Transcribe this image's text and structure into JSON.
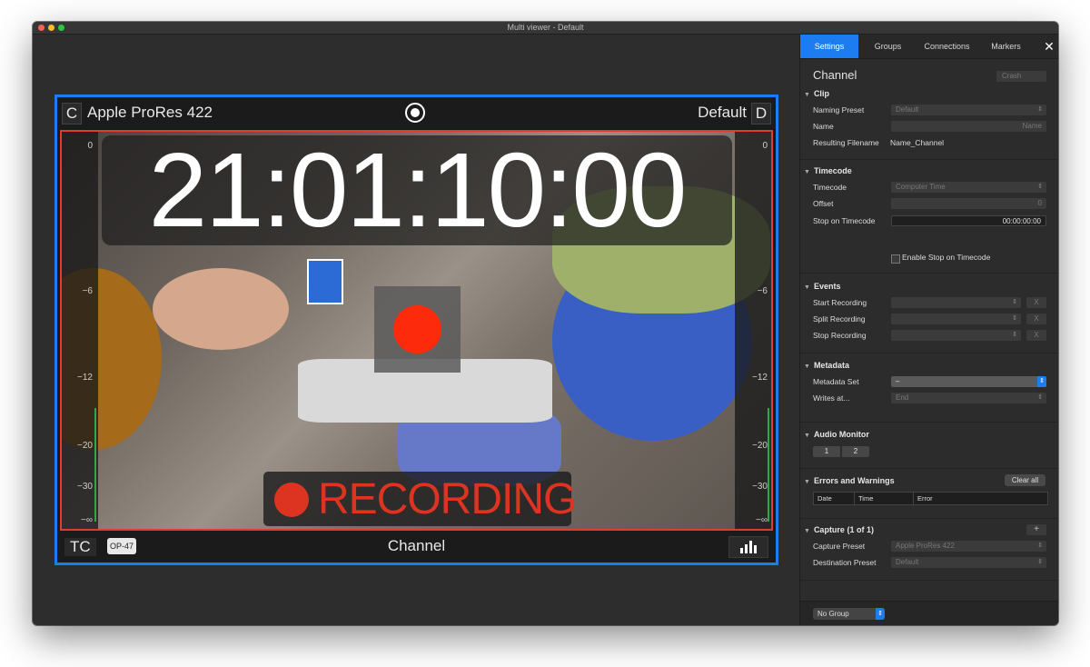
{
  "window": {
    "title": "Multi viewer - Default"
  },
  "viewer": {
    "left_letter": "C",
    "codec": "Apple ProRes 422",
    "preset": "Default",
    "right_letter": "D",
    "timecode": "21:01:10:00",
    "recording_label": "RECORDING",
    "tc_label": "TC",
    "op_badge": "OP-47",
    "channel_name": "Channel",
    "meter_labels": [
      "0",
      "−6",
      "−12",
      "−20",
      "−30",
      "−∞"
    ]
  },
  "panel": {
    "tabs": [
      "Settings",
      "Groups",
      "Connections",
      "Markers"
    ],
    "active_tab": "Settings",
    "close": "✕",
    "channel_title": "Channel",
    "channel_select": "Crash",
    "clip": {
      "header": "Clip",
      "naming_preset_label": "Naming Preset",
      "naming_preset_value": "Default",
      "name_label": "Name",
      "name_placeholder": "Name",
      "resulting_filename_label": "Resulting Filename",
      "resulting_filename_value": "Name_Channel"
    },
    "timecode": {
      "header": "Timecode",
      "timecode_label": "Timecode",
      "timecode_value": "Computer Time",
      "offset_label": "Offset",
      "offset_value": "0",
      "stop_label": "Stop on Timecode",
      "stop_value": "00:00:00:00",
      "enable_label": "Enable Stop on Timecode"
    },
    "events": {
      "header": "Events",
      "rows": [
        "Start Recording",
        "Split Recording",
        "Stop Recording"
      ],
      "clear_symbol": "X"
    },
    "metadata": {
      "header": "Metadata",
      "set_label": "Metadata Set",
      "set_value": "–",
      "writes_label": "Writes at...",
      "writes_value": "End"
    },
    "audio_monitor": {
      "header": "Audio Monitor",
      "channels": [
        "1",
        "2"
      ]
    },
    "errors": {
      "header": "Errors and Warnings",
      "clear_all": "Clear all",
      "columns": [
        "Date",
        "Time",
        "Error"
      ]
    },
    "capture": {
      "header": "Capture (1 of 1)",
      "add": "+",
      "capture_preset_label": "Capture Preset",
      "capture_preset_value": "Apple ProRes 422",
      "destination_preset_label": "Destination Preset",
      "destination_preset_value": "Default"
    },
    "group_select": "No Group"
  }
}
